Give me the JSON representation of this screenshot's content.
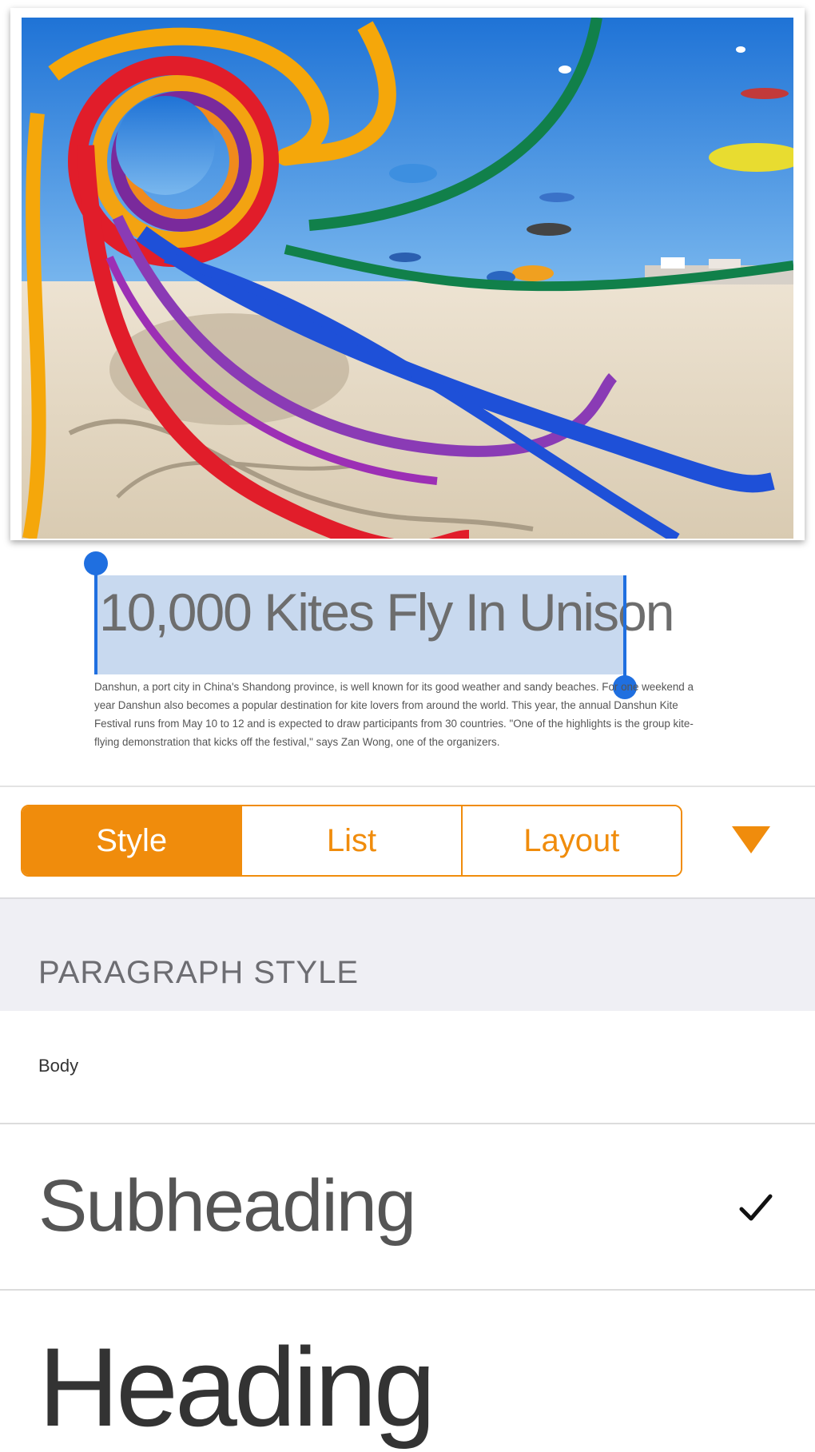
{
  "document": {
    "title": "10,000 Kites Fly In Unison",
    "body": "Danshun, a port city in China's Shandong province, is well known for its good weather and sandy beaches. For one weekend a year Danshun also becomes a popular destination for kite lovers from around the world. This year, the annual Danshun Kite Festival runs from May 10 to 12 and is expected to draw participants from 30 countries. \"One of the highlights is the group kite-flying demonstration that kicks off the festival,\" says Zan Wong, one of the organizers."
  },
  "toolbar": {
    "tabs": [
      {
        "label": "Style",
        "active": true
      },
      {
        "label": "List",
        "active": false
      },
      {
        "label": "Layout",
        "active": false
      }
    ],
    "dropdown_icon": "triangle-down-icon",
    "accent_color": "#f08c0c"
  },
  "paragraph_style": {
    "header": "PARAGRAPH STYLE",
    "options": [
      {
        "label": "Body",
        "selected": false
      },
      {
        "label": "Subheading",
        "selected": true
      },
      {
        "label": "Heading",
        "selected": false
      }
    ],
    "selected_icon": "checkmark-icon"
  },
  "selection": {
    "highlight_color": "#c8d9ef",
    "handle_color": "#1f6fe0"
  }
}
